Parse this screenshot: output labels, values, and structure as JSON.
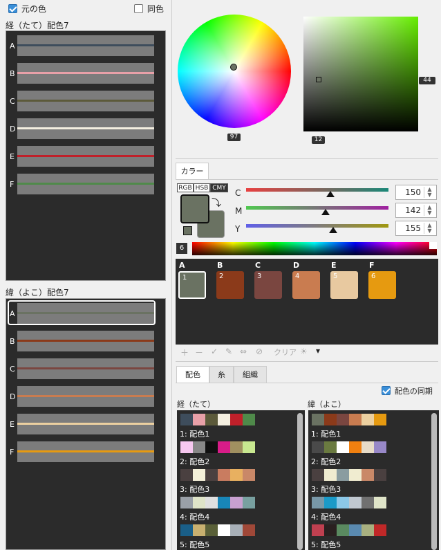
{
  "top": {
    "original_color_label": "元の色",
    "same_color_label": "同色"
  },
  "warp": {
    "title": "経（たて）配色7",
    "rows": [
      {
        "letter": "A",
        "color": "#3e4d5c"
      },
      {
        "letter": "B",
        "color": "#e8a0a8"
      },
      {
        "letter": "C",
        "color": "#5c5a3a"
      },
      {
        "letter": "D",
        "color": "#f4efe0"
      },
      {
        "letter": "E",
        "color": "#c0202a"
      },
      {
        "letter": "F",
        "color": "#4f8a4a"
      }
    ]
  },
  "weft": {
    "title": "緯（よこ）配色7",
    "rows": [
      {
        "letter": "A",
        "color": "#6a7262"
      },
      {
        "letter": "B",
        "color": "#8b3a1a"
      },
      {
        "letter": "C",
        "color": "#7a4640"
      },
      {
        "letter": "D",
        "color": "#c97c50"
      },
      {
        "letter": "E",
        "color": "#ecd0a0"
      },
      {
        "letter": "F",
        "color": "#e69a10"
      }
    ]
  },
  "picker": {
    "hue_value": "97",
    "value_marker": "44",
    "sat_marker": "12",
    "color_tab": "カラー"
  },
  "modes": [
    "RGB",
    "HSB",
    "CMY"
  ],
  "sliders": [
    {
      "label": "C",
      "value": "150",
      "fraction": 0.59
    },
    {
      "label": "M",
      "value": "142",
      "fraction": 0.56
    },
    {
      "label": "Y",
      "value": "155",
      "fraction": 0.61
    }
  ],
  "spectrum_count": "6",
  "palette": [
    {
      "letter": "A",
      "num": "1",
      "color": "#6a7262"
    },
    {
      "letter": "B",
      "num": "2",
      "color": "#8b3a1a"
    },
    {
      "letter": "C",
      "num": "3",
      "color": "#7a4640"
    },
    {
      "letter": "D",
      "num": "4",
      "color": "#c97c50"
    },
    {
      "letter": "E",
      "num": "5",
      "color": "#e8c9a0"
    },
    {
      "letter": "F",
      "num": "6",
      "color": "#e69a10"
    }
  ],
  "toolbar": {
    "clear_label": "クリア"
  },
  "bottom_tabs": [
    "配色",
    "糸",
    "組織"
  ],
  "sync_label": "配色の同期",
  "warp_list_title": "経（たて）",
  "weft_list_title": "緯（よこ）",
  "warp_combos": [
    {
      "label": "1: 配色1",
      "colors": [
        "#3e4d5c",
        "#e8a0a8",
        "#5c5a3a",
        "#f4efe0",
        "#c0202a",
        "#4f8a4a"
      ]
    },
    {
      "label": "2: 配色2",
      "colors": [
        "#f7c8f0",
        "#888888",
        "#111111",
        "#d81c88",
        "#a09060",
        "#c8e890"
      ]
    },
    {
      "label": "3: 配色3",
      "colors": [
        "#4a4040",
        "#f4efd8",
        "#4a4040",
        "#c97c60",
        "#e8b060",
        "#c98868"
      ]
    },
    {
      "label": "4: 配色4",
      "colors": [
        "#9aa0a8",
        "#dfe4c8",
        "#e0e0e0",
        "#1886b8",
        "#c8a0d0",
        "#78a0a0"
      ]
    },
    {
      "label": "5: 配色5",
      "colors": [
        "#1a5f88",
        "#c8b070",
        "#5a6038",
        "#ffffff",
        "#a8b0b8",
        "#a04838"
      ]
    }
  ],
  "weft_combos": [
    {
      "label": "1: 配色1",
      "colors": [
        "#6a7262",
        "#8b3a1a",
        "#7a4640",
        "#c97c50",
        "#ecd0a0",
        "#e69a10"
      ]
    },
    {
      "label": "2: 配色2",
      "colors": [
        "#4a4a4a",
        "#6a7a40",
        "#ffffff",
        "#f08010",
        "#e8dcc8",
        "#9888c8"
      ]
    },
    {
      "label": "3: 配色3",
      "colors": [
        "#4a4040",
        "#f0ebd0",
        "#8a9ca0",
        "#f0ecd0",
        "#c98868",
        "#4a4040"
      ]
    },
    {
      "label": "4: 配色4",
      "colors": [
        "#7898a8",
        "#1a9ac8",
        "#8cc8e8",
        "#c0c8d0",
        "#707070",
        "#dfe4c8"
      ]
    },
    {
      "label": "5: 配色5",
      "colors": [
        "#c04050",
        "#2a2020",
        "#5a8a60",
        "#5a8ab0",
        "#a8b080",
        "#c02828"
      ]
    }
  ]
}
